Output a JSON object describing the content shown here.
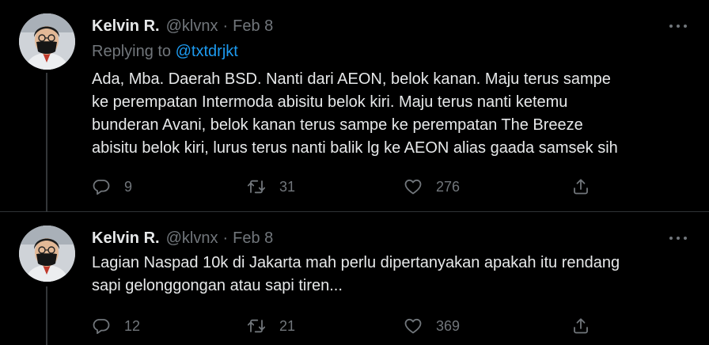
{
  "tweets": [
    {
      "author_name": "Kelvin R.",
      "handle": "@klvnx",
      "separator": "·",
      "date": "Feb 8",
      "replying_prefix": "Replying to",
      "replying_to": "@txtdrjkt",
      "lines": [
        "Ada, Mba. Daerah BSD. Nanti dari AEON, belok kanan. Maju terus sampe",
        "ke perempatan Intermoda abisitu belok kiri. Maju terus nanti ketemu",
        "bunderan Avani, belok kanan terus sampe ke perempatan The Breeze",
        "abisitu belok kiri, lurus terus nanti balik lg ke AEON alias gaada samsek sih"
      ],
      "replies": "9",
      "retweets": "31",
      "likes": "276"
    },
    {
      "author_name": "Kelvin R.",
      "handle": "@klvnx",
      "separator": "·",
      "date": "Feb 8",
      "lines": [
        "Lagian Naspad 10k di Jakarta mah perlu dipertanyakan apakah itu rendang",
        "sapi gelonggongan atau sapi tiren..."
      ],
      "replies": "12",
      "retweets": "21",
      "likes": "369"
    }
  ],
  "colors": {
    "background": "#000000",
    "text_primary": "#e7e9ea",
    "text_secondary": "#71767b",
    "link": "#1d9bf0",
    "divider": "#2f3336"
  },
  "icons": [
    "avatar-photo",
    "more-icon",
    "reply-icon",
    "retweet-icon",
    "like-icon",
    "share-icon"
  ]
}
